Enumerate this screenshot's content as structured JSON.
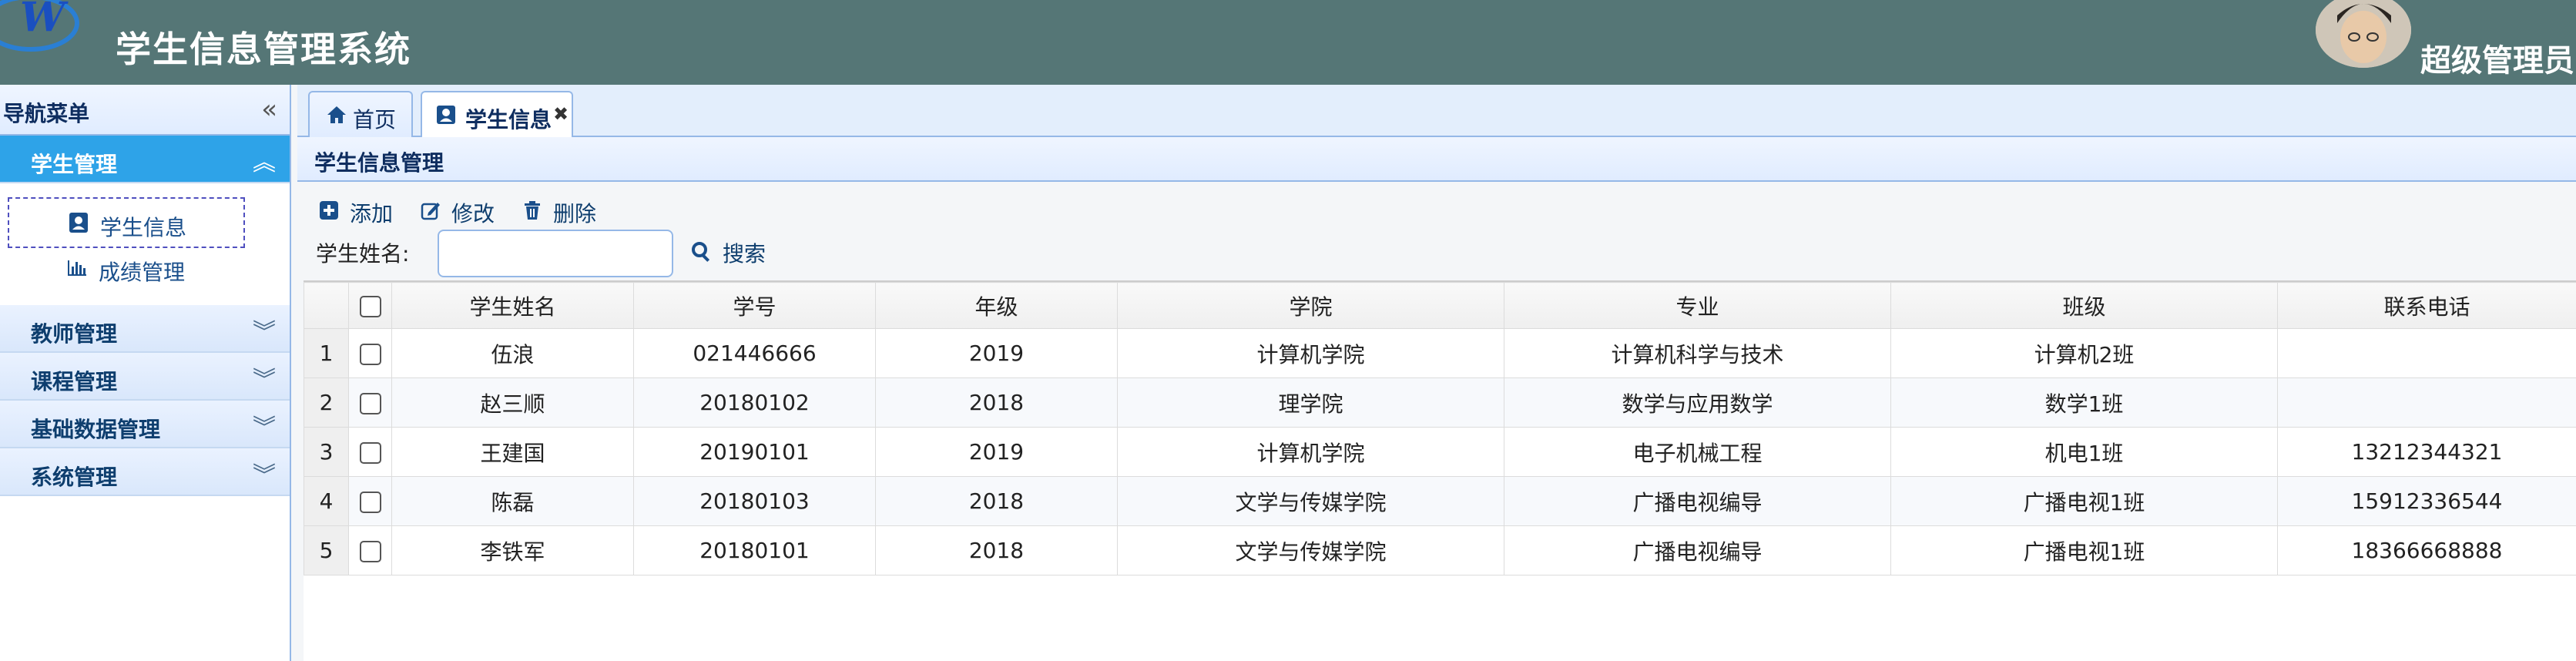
{
  "app": {
    "title": "学生信息管理系统",
    "user": "超级管理员"
  },
  "sidebar": {
    "title": "导航菜单",
    "groups": [
      {
        "label": "学生管理",
        "active": true,
        "items": [
          {
            "label": "学生信息",
            "icon": "user-card-icon",
            "selected": true
          },
          {
            "label": "成绩管理",
            "icon": "bar-chart-icon"
          }
        ]
      },
      {
        "label": "教师管理"
      },
      {
        "label": "课程管理"
      },
      {
        "label": "基础数据管理"
      },
      {
        "label": "系统管理"
      }
    ]
  },
  "tabs": [
    {
      "label": "首页",
      "icon": "home-icon"
    },
    {
      "label": "学生信息",
      "icon": "user-card-icon",
      "selected": true,
      "closable": true
    }
  ],
  "panel": {
    "title": "学生信息管理"
  },
  "toolbar": {
    "add": "添加",
    "edit": "修改",
    "delete": "删除",
    "search_label": "学生姓名:",
    "search_value": "",
    "search_button": "搜索"
  },
  "table": {
    "columns": [
      "学生姓名",
      "学号",
      "年级",
      "学院",
      "专业",
      "班级",
      "联系电话"
    ],
    "rows": [
      [
        "1",
        "伍浪",
        "021446666",
        "2019",
        "计算机学院",
        "计算机科学与技术",
        "计算机2班",
        ""
      ],
      [
        "2",
        "赵三顺",
        "20180102",
        "2018",
        "理学院",
        "数学与应用数学",
        "数学1班",
        ""
      ],
      [
        "3",
        "王建国",
        "20190101",
        "2019",
        "计算机学院",
        "电子机械工程",
        "机电1班",
        "13212344321"
      ],
      [
        "4",
        "陈磊",
        "20180103",
        "2018",
        "文学与传媒学院",
        "广播电视编导",
        "广播电视1班",
        "15912336544"
      ],
      [
        "5",
        "李铁军",
        "20180101",
        "2018",
        "文学与传媒学院",
        "广播电视编导",
        "广播电视1班",
        "18366668888"
      ]
    ]
  },
  "colors": {
    "header": "#557676",
    "accent": "#2ea3e8",
    "border": "#95b8e7"
  }
}
